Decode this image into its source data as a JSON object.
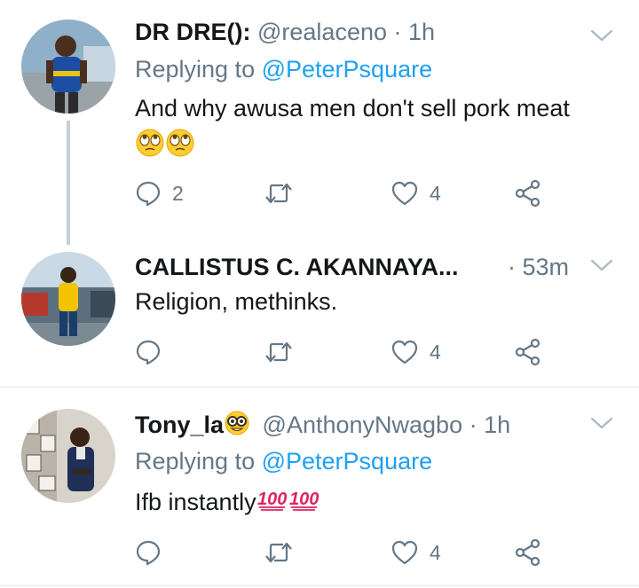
{
  "tweets": [
    {
      "name": "DR DRE():",
      "handle": "@realaceno",
      "separator": "·",
      "time": "1h",
      "replying_label": "Replying to",
      "replying_handle": "@PeterPsquare",
      "text": "And why awusa men don't sell pork meat",
      "emojis": [
        "face-with-rolling-eyes",
        "face-with-rolling-eyes"
      ],
      "replies": "2",
      "retweets": "",
      "likes": "4"
    },
    {
      "name": "CALLISTUS C. AKANNAYA...",
      "handle": "",
      "separator": "·",
      "time": "53m",
      "text": "Religion, methinks.",
      "replies": "",
      "retweets": "",
      "likes": "4"
    },
    {
      "name": "Tony_la",
      "name_emoji": "nerd-face",
      "handle": "@AnthonyNwagbo",
      "separator": "·",
      "time": "1h",
      "replying_label": "Replying to",
      "replying_handle": "@PeterPsquare",
      "text": "Ifb instantly",
      "emojis": [
        "hundred-points",
        "hundred-points"
      ],
      "replies": "",
      "retweets": "",
      "likes": "4"
    }
  ],
  "colors": {
    "text": "#14171a",
    "secondary": "#657786",
    "link": "#1da1f2",
    "divider": "#e1e8ed",
    "thread_line": "#c4cfd6"
  }
}
